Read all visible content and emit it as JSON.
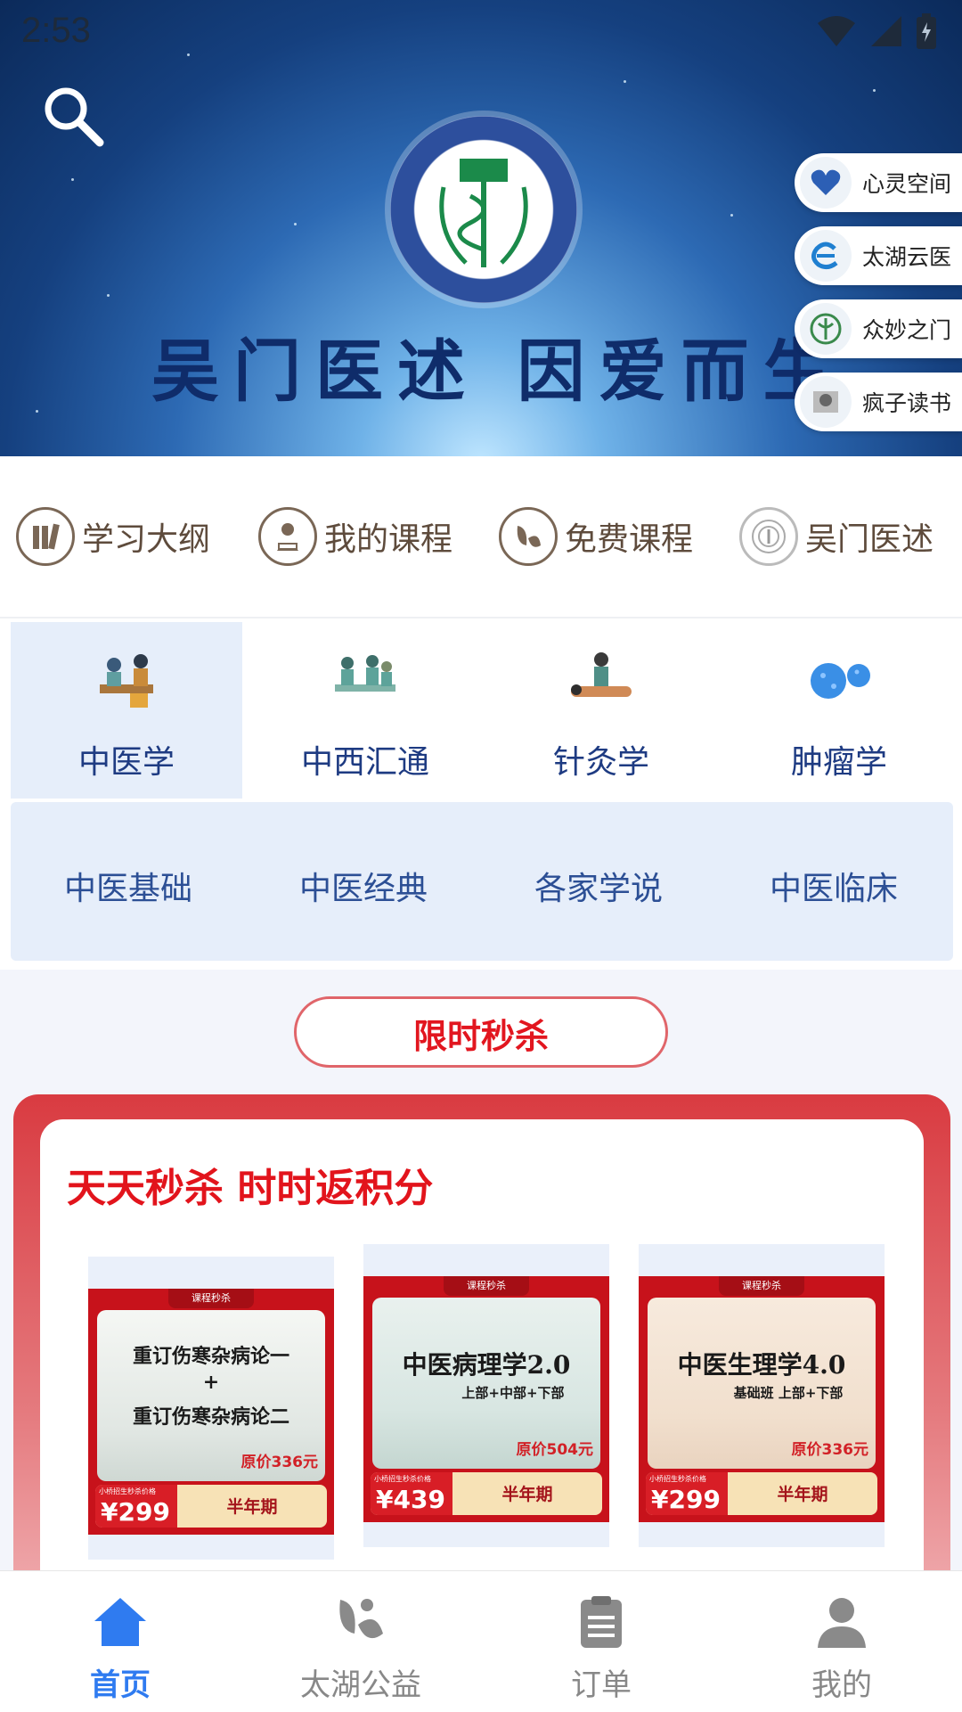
{
  "status_bar": {
    "time": "2:53"
  },
  "hero": {
    "logo_text": "吴门医述",
    "slogan": "吴门医述 因爱而生"
  },
  "side_links": [
    {
      "label": "心灵空间",
      "icon": "heart-logo-icon"
    },
    {
      "label": "太湖云医",
      "icon": "cloud-doctor-logo-icon"
    },
    {
      "label": "众妙之门",
      "icon": "seal-logo-icon"
    },
    {
      "label": "疯子读书",
      "icon": "book-club-logo-icon"
    }
  ],
  "quick_nav": [
    {
      "label": "学习大纲",
      "icon": "books-icon"
    },
    {
      "label": "我的课程",
      "icon": "reader-icon"
    },
    {
      "label": "免费课程",
      "icon": "leaf-icon"
    },
    {
      "label": "吴门医述",
      "icon": "university-seal-icon"
    }
  ],
  "categories": [
    {
      "label": "中医学",
      "active": true
    },
    {
      "label": "中西汇通",
      "active": false
    },
    {
      "label": "针灸学",
      "active": false
    },
    {
      "label": "肿瘤学",
      "active": false
    }
  ],
  "subcategories": [
    "中医基础",
    "中医经典",
    "各家学说",
    "中医临床"
  ],
  "flash_sale": {
    "section_title": "限时秒杀",
    "headline": "天天秒杀 时时返积分",
    "products": [
      {
        "tag": "课程秒杀",
        "title_line1": "重订伤寒杂病论一",
        "title_line2": "+",
        "title_line3": "重订伤寒杂病论二",
        "original_price": "原价336元",
        "mini_label": "小桥招生秒杀价格",
        "price": "¥299",
        "period": "半年期"
      },
      {
        "tag": "课程秒杀",
        "title_line1": "中医病理学2.0",
        "title_line2": "上部+中部+下部",
        "original_price": "原价504元",
        "mini_label": "小桥招生秒杀价格",
        "price": "¥439",
        "period": "半年期"
      },
      {
        "tag": "课程秒杀",
        "title_line1": "中医生理学4.0",
        "title_line2": "基础班 上部+下部",
        "original_price": "原价336元",
        "mini_label": "小桥招生秒杀价格",
        "price": "¥299",
        "period": "半年期"
      }
    ]
  },
  "tab_bar": [
    {
      "label": "首页",
      "icon": "home-icon",
      "active": true
    },
    {
      "label": "太湖公益",
      "icon": "charity-leaf-icon",
      "active": false
    },
    {
      "label": "订单",
      "icon": "order-clipboard-icon",
      "active": false
    },
    {
      "label": "我的",
      "icon": "profile-icon",
      "active": false
    }
  ],
  "colors": {
    "accent_blue": "#2f7bf0",
    "sale_red": "#e2141c",
    "nav_brown": "#5e4b3c",
    "category_blue": "#1e3b82"
  }
}
